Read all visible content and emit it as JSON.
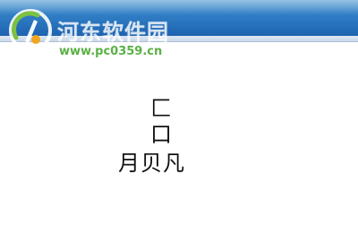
{
  "watermark": {
    "site_name": "河东软件园",
    "url": "www.pc0359.cn"
  },
  "content": {
    "lines": [
      "匚",
      "口",
      "月贝凡"
    ]
  },
  "colors": {
    "titlebar": "#2f7cc4",
    "watermark_url": "#4aa832",
    "text": "#111111"
  }
}
